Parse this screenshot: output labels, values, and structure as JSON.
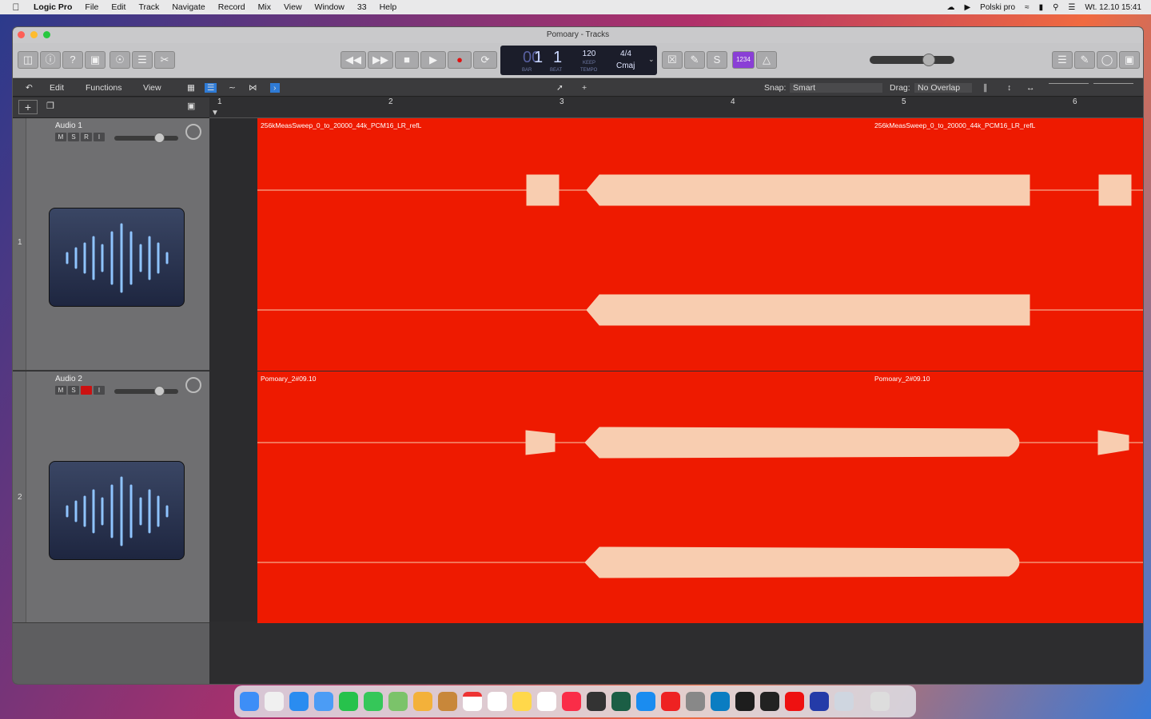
{
  "menubar": {
    "app": "Logic Pro",
    "items": [
      "File",
      "Edit",
      "Track",
      "Navigate",
      "Record",
      "Mix",
      "View",
      "Window",
      "33",
      "Help"
    ],
    "keyboard": "Polski pro",
    "clock": "Wt. 12.10  15:41"
  },
  "window": {
    "title": "Pomoary - Tracks"
  },
  "lcd": {
    "bar": "1",
    "beat": "1",
    "bar_label": "BAR",
    "beat_label": "BEAT",
    "tempo": "120",
    "keep": "KEEP",
    "tempo_label": "TEMPO",
    "signature": "4/4",
    "key": "Cmaj",
    "counter": "1234"
  },
  "controlbar": {
    "edit": "Edit",
    "functions": "Functions",
    "view": "View",
    "snap_label": "Snap:",
    "snap_value": "Smart",
    "drag_label": "Drag:",
    "drag_value": "No Overlap"
  },
  "ruler": {
    "marks": [
      "1",
      "2",
      "3",
      "4",
      "5",
      "6"
    ]
  },
  "tracks": [
    {
      "number": "1",
      "name": "Audio 1",
      "buttons": [
        "M",
        "S",
        "R",
        "I"
      ],
      "region_a": "256kMeasSweep_0_to_20000_44k_PCM16_LR_refL",
      "region_b": "256kMeasSweep_0_to_20000_44k_PCM16_LR_refL"
    },
    {
      "number": "2",
      "name": "Audio 2",
      "buttons": [
        "M",
        "S",
        "R",
        "I"
      ],
      "region_a": "Pomoary_2#09.10",
      "region_b": "Pomoary_2#09.10"
    }
  ],
  "colors": {
    "region": "#ee1a00",
    "waveform": "#f8cdb0",
    "lcd": "#1b1d2a"
  }
}
